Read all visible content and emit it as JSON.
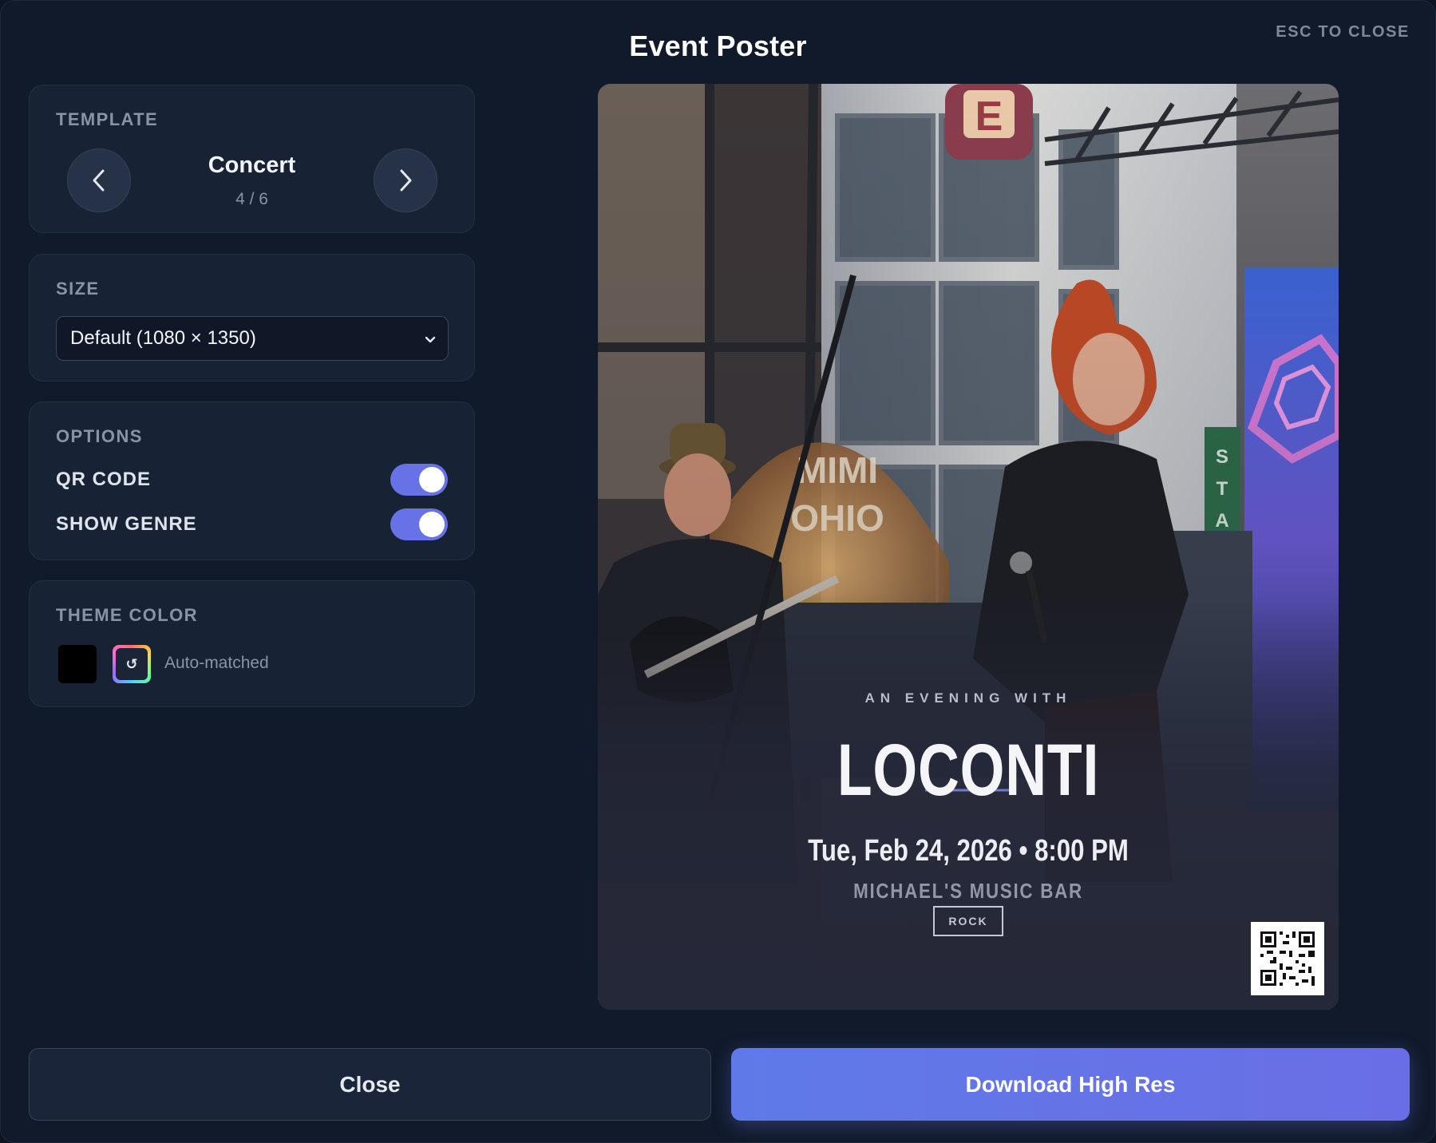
{
  "modal": {
    "title": "Event Poster",
    "esc_hint": "ESC TO CLOSE"
  },
  "template": {
    "label": "TEMPLATE",
    "name": "Concert",
    "counter": "4 / 6"
  },
  "size": {
    "label": "SIZE",
    "selected": "Default (1080 × 1350)"
  },
  "options": {
    "label": "OPTIONS",
    "items": [
      {
        "label": "QR CODE",
        "enabled": true
      },
      {
        "label": "SHOW GENRE",
        "enabled": true
      }
    ]
  },
  "theme": {
    "label": "THEME COLOR",
    "swatch_color": "#000000",
    "auto_label": "Auto-matched",
    "auto_icon": "↺"
  },
  "poster": {
    "eyebrow": "AN EVENING WITH",
    "headliner": "LOCONTI",
    "datetime": "Tue, Feb 24, 2026 • 8:00 PM",
    "venue": "MICHAEL'S MUSIC BAR",
    "genre": "ROCK",
    "signs": {
      "marquee_letter": "E",
      "theater_sign": "MIMI OHIO",
      "banner": "STAT"
    }
  },
  "footer": {
    "close_label": "Close",
    "download_label": "Download High Res"
  },
  "colors": {
    "accent": "#6672e6",
    "background": "#111a2b",
    "panel": "#182235"
  }
}
